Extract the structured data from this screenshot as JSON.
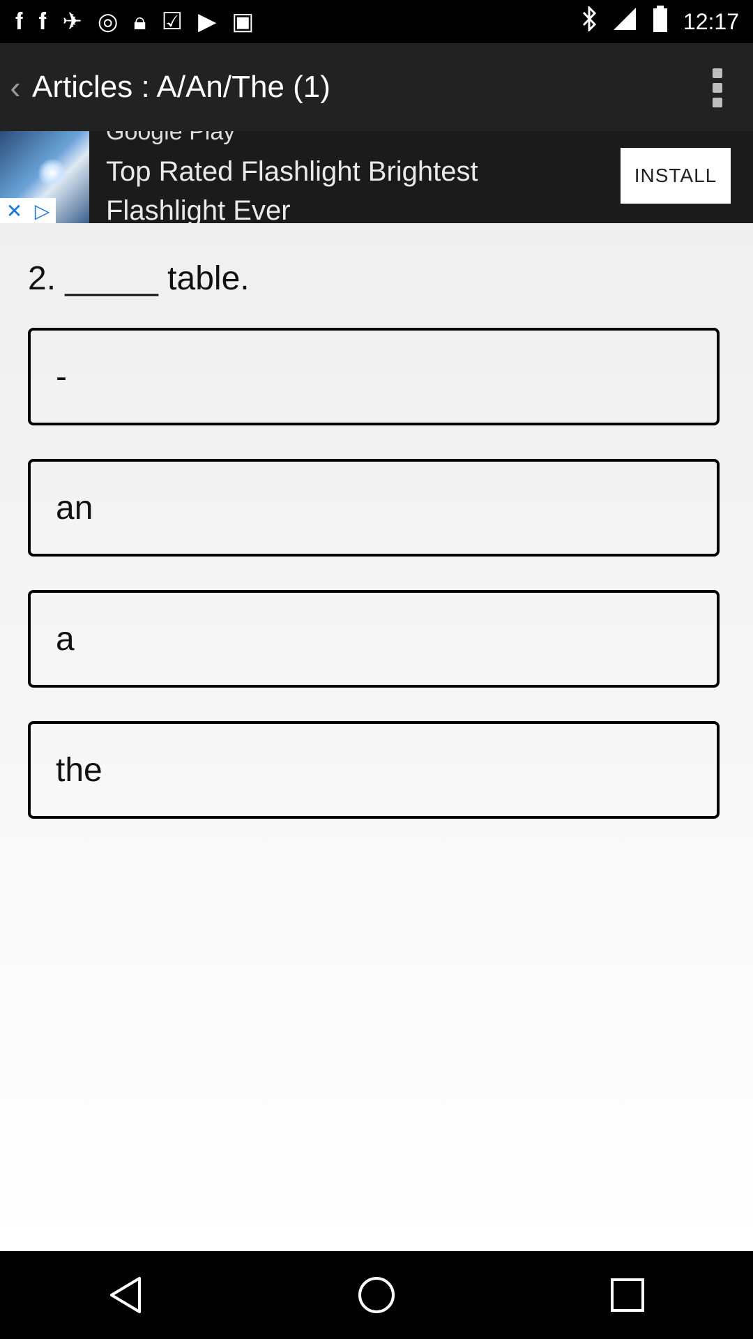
{
  "status_bar": {
    "time": "12:17",
    "left_icons": [
      "facebook-icon",
      "facebook-icon",
      "fake-gps-icon",
      "data-saver-icon",
      "lock-icon",
      "briefcase-check-icon",
      "play-store-icon",
      "cat-icon"
    ],
    "right_icons": [
      "bluetooth-icon",
      "signal-icon",
      "battery-icon"
    ]
  },
  "app_bar": {
    "title": "Articles : A/An/The (1)"
  },
  "ad": {
    "top_text": "Google Play",
    "line1": "Top Rated Flashlight Brightest",
    "line2": "Flashlight Ever",
    "install_label": "INSTALL"
  },
  "question": {
    "text": "2. _____ table."
  },
  "options": [
    "-",
    "an",
    "a",
    "the"
  ],
  "colors": {
    "app_bar_bg": "#222222",
    "status_bar_bg": "#000000",
    "option_border": "#000000"
  }
}
